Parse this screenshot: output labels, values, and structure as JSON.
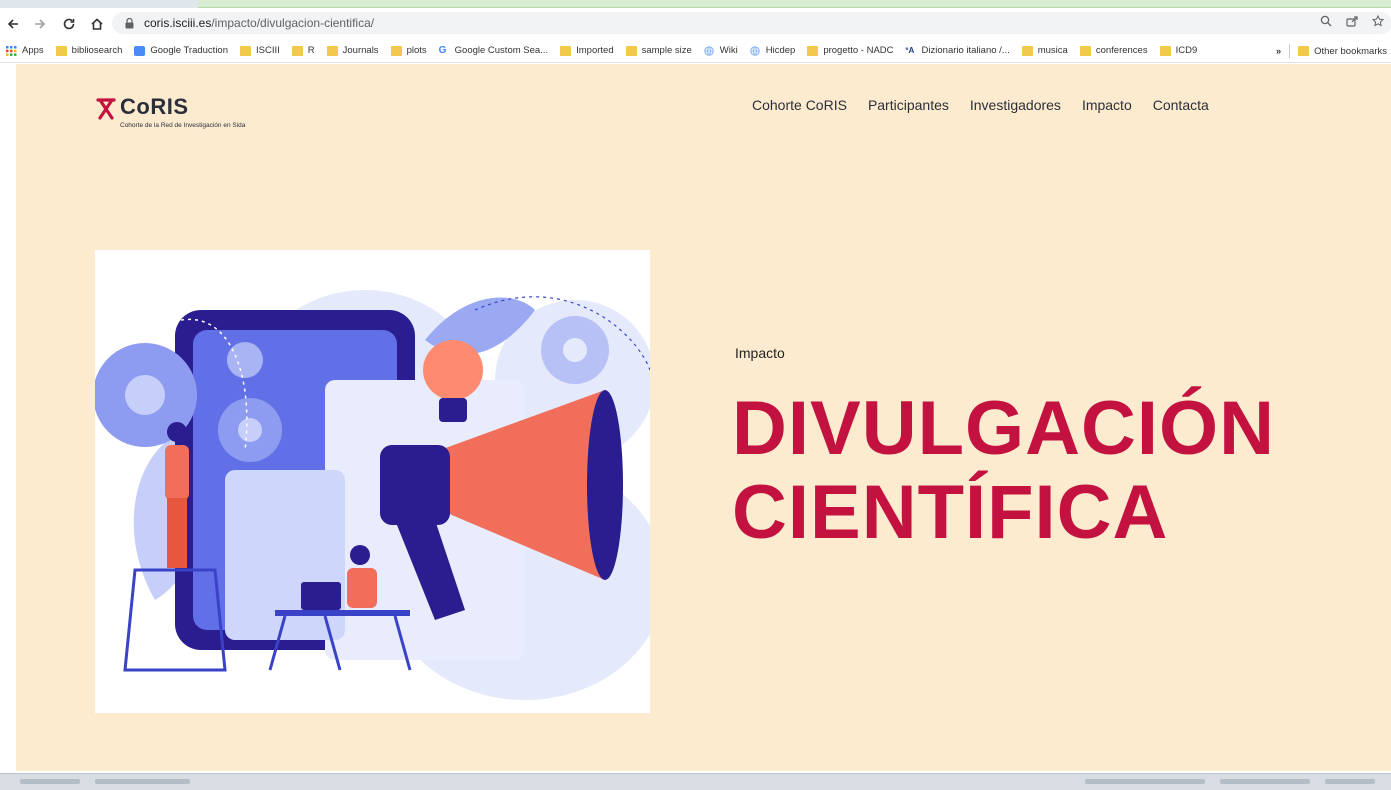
{
  "browser": {
    "url_host": "coris.isciii.es",
    "url_path": "/impacto/divulgacion-cientifica/"
  },
  "bookmarks": {
    "items": [
      {
        "label": "Apps",
        "icon": "apps-grid-icon",
        "color": "#4285f4"
      },
      {
        "label": "bibliosearch",
        "icon": "folder-icon"
      },
      {
        "label": "Google Traduction",
        "icon": "translate-icon"
      },
      {
        "label": "ISCIII",
        "icon": "folder-icon"
      },
      {
        "label": "R",
        "icon": "folder-icon"
      },
      {
        "label": "Journals",
        "icon": "folder-icon"
      },
      {
        "label": "plots",
        "icon": "folder-icon"
      },
      {
        "label": "Google Custom Sea...",
        "icon": "google-icon"
      },
      {
        "label": "Imported",
        "icon": "folder-icon"
      },
      {
        "label": "sample size",
        "icon": "folder-icon"
      },
      {
        "label": "Wiki",
        "icon": "globe-icon"
      },
      {
        "label": "Hicdep",
        "icon": "globe-icon"
      },
      {
        "label": "progetto - NADC",
        "icon": "folder-icon"
      },
      {
        "label": "Dizionario italiano /...",
        "icon": "dictionary-icon"
      },
      {
        "label": "musica",
        "icon": "folder-icon"
      },
      {
        "label": "conferences",
        "icon": "folder-icon"
      },
      {
        "label": "ICD9",
        "icon": "folder-icon"
      }
    ],
    "overflow": "»",
    "other": "Other bookmarks"
  },
  "site": {
    "logo_text": "CoRIS",
    "logo_sub": "Cohorte de la Red de Investigación en Sida",
    "nav": [
      "Cohorte CoRIS",
      "Participantes",
      "Investigadores",
      "Impacto",
      "Contacta"
    ]
  },
  "hero": {
    "eyebrow": "Impacto",
    "title_line1": "DIVULGACIÓN",
    "title_line2": "CIENTÍFICA",
    "title_color": "#c3123f",
    "background": "#fdebd0"
  }
}
